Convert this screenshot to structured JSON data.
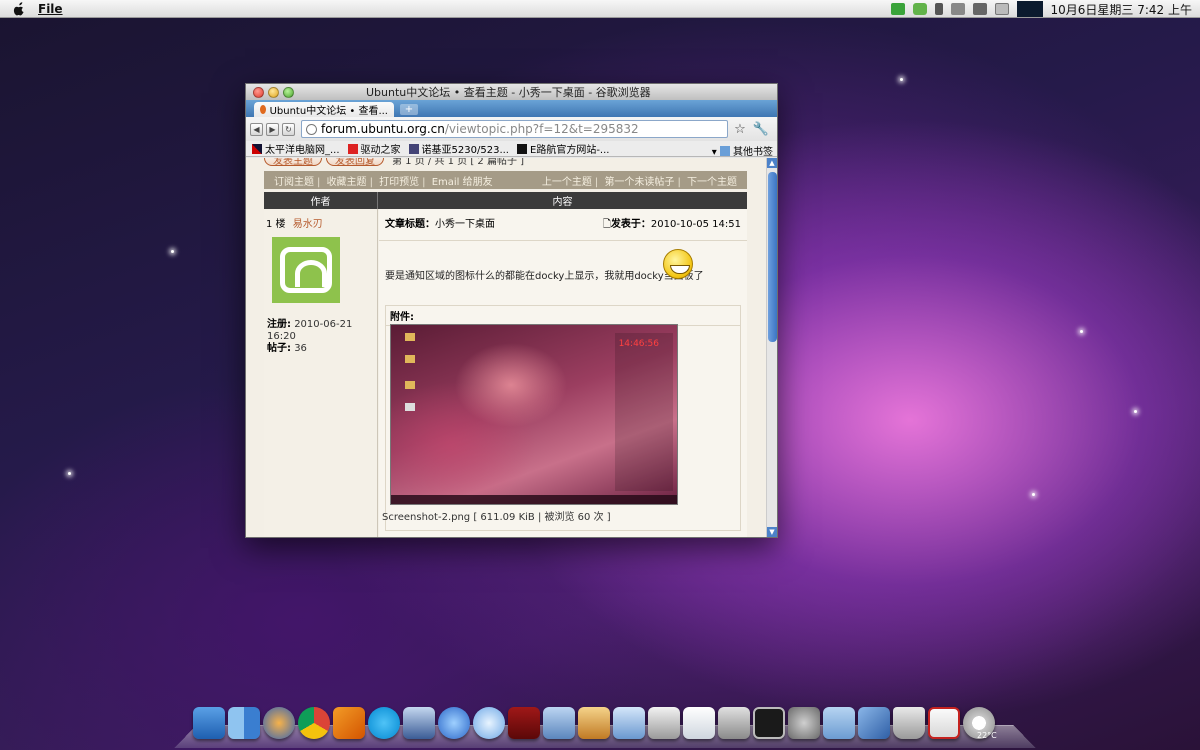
{
  "menubar": {
    "app_menu": "File",
    "clock": "10月6日星期三  7:42 上午"
  },
  "browser": {
    "window_title": "Ubuntu中文论坛 • 查看主题 - 小秀一下桌面 - 谷歌浏览器",
    "tab_label": "Ubuntu中文论坛 • 查看...",
    "new_tab_label": "+",
    "url_host": "forum.ubuntu.org.cn",
    "url_path": "/viewtopic.php?f=12&t=295832",
    "bookmarks": [
      "太平洋电脑网_...",
      "驱动之家",
      "诺基亚5230/523...",
      "E路航官方网站-..."
    ],
    "other_bookmarks": "其他书签"
  },
  "forum": {
    "buttons": [
      "发表主题",
      "发表回复"
    ],
    "pagination": "第 1 页 / 共 1 页 [ 2 篇帖子 ]",
    "topic_links_left": [
      "订阅主题",
      "收藏主题",
      "打印预览",
      "Email 给朋友"
    ],
    "topic_links_right": [
      "上一个主题",
      "第一个未读帖子",
      "下一个主题"
    ],
    "col_author": "作者",
    "col_content": "内容",
    "floor_label": "1 楼",
    "author_name": "易水刃",
    "register_label": "注册:",
    "register_date": "2010-06-21 16:20",
    "posts_label": "帖子:",
    "posts_count": "36",
    "post_title_label": "文章标题：",
    "post_title": "小秀一下桌面",
    "post_time_label": "发表于：",
    "post_time": "2010-10-05 14:51",
    "post_body": "要是通知区域的图标什么的都能在docky上显示，我就用docky当面板了",
    "attachment_label": "附件:",
    "attachment_caption": "Screenshot-2.png [ 611.09 KiB | 被浏览 60 次 ]",
    "screenshot_clock": "14:46:56"
  },
  "dock": {
    "items": [
      "anchor-icon",
      "finder-icon",
      "thunderbird-icon",
      "chrome-icon",
      "crossover-icon",
      "skype-icon",
      "preview-icon",
      "messenger-icon",
      "itunes-icon",
      "photo-booth-icon",
      "iphoto-icon",
      "image-capture-icon",
      "screen-sharing-icon",
      "scanner-icon",
      "text-edit-icon",
      "calculator-icon",
      "terminal-icon",
      "system-prefs-icon",
      "folder-icon",
      "virtualbox-icon",
      "trash-icon",
      "gmail-icon",
      "weather-icon"
    ],
    "weather_temp": "22°C"
  },
  "colors": {
    "forum_accent": "#b65a2c",
    "topic_bar": "#a59b87",
    "tab_strip": "#3f76b3"
  }
}
